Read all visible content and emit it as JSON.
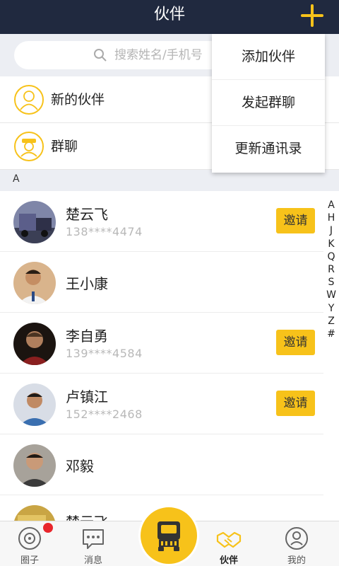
{
  "header": {
    "title": "伙伴"
  },
  "search": {
    "placeholder": "搜索姓名/手机号"
  },
  "menu": {
    "new_partner": "新的伙伴",
    "group_chat": "群聊"
  },
  "popup": {
    "items": [
      "添加伙伴",
      "发起群聊",
      "更新通讯录"
    ]
  },
  "section": {
    "letter": "A"
  },
  "contacts": [
    {
      "name": "楚云飞",
      "phone": "138****4474",
      "invite": "邀请"
    },
    {
      "name": "王小康",
      "phone": "",
      "invite": ""
    },
    {
      "name": "李自勇",
      "phone": "139****4584",
      "invite": "邀请"
    },
    {
      "name": "卢镇江",
      "phone": "152****2468",
      "invite": "邀请"
    },
    {
      "name": "邓毅",
      "phone": "",
      "invite": ""
    },
    {
      "name": "楚云飞",
      "phone": "",
      "invite": ""
    }
  ],
  "index_letters": [
    "A",
    "H",
    "J",
    "K",
    "Q",
    "R",
    "S",
    "W",
    "Y",
    "Z",
    "#"
  ],
  "tabs": [
    {
      "label": "圈子"
    },
    {
      "label": "消息"
    },
    {
      "label": "伙伴"
    },
    {
      "label": "我的"
    }
  ],
  "colors": {
    "header_bg": "#20293f",
    "accent": "#f7c21a",
    "badge": "#e8262c"
  }
}
